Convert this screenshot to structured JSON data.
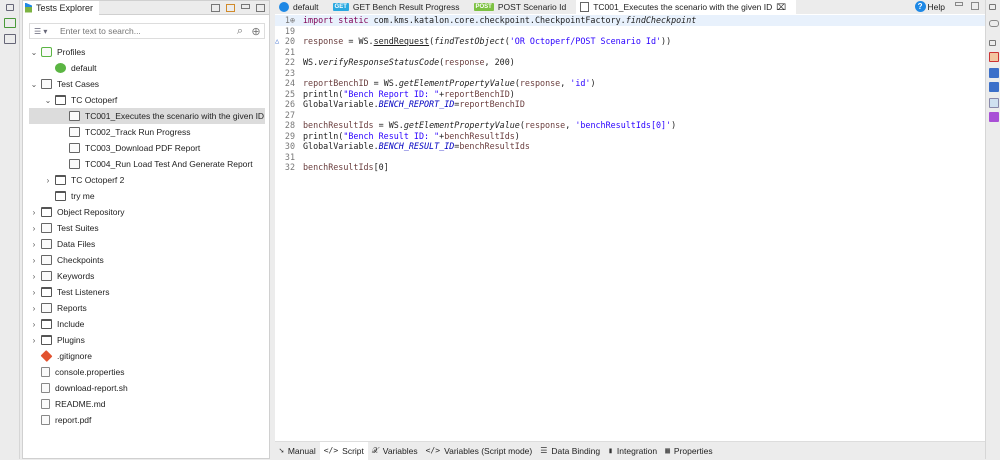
{
  "explorer": {
    "title": "Tests Explorer",
    "search_placeholder": "Enter text to search...",
    "tree": [
      {
        "label": "Profiles",
        "depth": 0,
        "chev": "v",
        "icon": "profile"
      },
      {
        "label": "default",
        "depth": 1,
        "chev": "",
        "icon": "green"
      },
      {
        "label": "Test Cases",
        "depth": 0,
        "chev": "v",
        "icon": "tc"
      },
      {
        "label": "TC Octoperf",
        "depth": 1,
        "chev": "v",
        "icon": "folder"
      },
      {
        "label": "TC001_Executes the scenario with the given ID",
        "depth": 2,
        "chev": "",
        "icon": "tc",
        "selected": true
      },
      {
        "label": "TC002_Track Run Progress",
        "depth": 2,
        "chev": "",
        "icon": "tc"
      },
      {
        "label": "TC003_Download PDF Report",
        "depth": 2,
        "chev": "",
        "icon": "tc"
      },
      {
        "label": "TC004_Run Load Test And Generate Report",
        "depth": 2,
        "chev": "",
        "icon": "tc"
      },
      {
        "label": "TC Octoperf 2",
        "depth": 1,
        "chev": ">",
        "icon": "folder"
      },
      {
        "label": "try me",
        "depth": 1,
        "chev": "",
        "icon": "folder"
      },
      {
        "label": "Object Repository",
        "depth": 0,
        "chev": ">",
        "icon": "folder"
      },
      {
        "label": "Test Suites",
        "depth": 0,
        "chev": ">",
        "icon": "tc"
      },
      {
        "label": "Data Files",
        "depth": 0,
        "chev": ">",
        "icon": "tc"
      },
      {
        "label": "Checkpoints",
        "depth": 0,
        "chev": ">",
        "icon": "tc"
      },
      {
        "label": "Keywords",
        "depth": 0,
        "chev": ">",
        "icon": "tc"
      },
      {
        "label": "Test Listeners",
        "depth": 0,
        "chev": ">",
        "icon": "folder"
      },
      {
        "label": "Reports",
        "depth": 0,
        "chev": ">",
        "icon": "tc"
      },
      {
        "label": "Include",
        "depth": 0,
        "chev": ">",
        "icon": "folder"
      },
      {
        "label": "Plugins",
        "depth": 0,
        "chev": ">",
        "icon": "folder"
      },
      {
        "label": ".gitignore",
        "depth": 0,
        "chev": "",
        "icon": "git"
      },
      {
        "label": "console.properties",
        "depth": 0,
        "chev": "",
        "icon": "file"
      },
      {
        "label": "download-report.sh",
        "depth": 0,
        "chev": "",
        "icon": "file"
      },
      {
        "label": "README.md",
        "depth": 0,
        "chev": "",
        "icon": "file"
      },
      {
        "label": "report.pdf",
        "depth": 0,
        "chev": "",
        "icon": "file"
      }
    ]
  },
  "editor": {
    "tabs": [
      {
        "label": "default",
        "badge": "",
        "icon": "x-profile-icon"
      },
      {
        "label": "GET Bench Result Progress",
        "badge": "GET",
        "badge_color": "#29a8e0"
      },
      {
        "label": "POST Scenario Id",
        "badge": "POST",
        "badge_color": "#7cc142"
      },
      {
        "label": "TC001_Executes the scenario with the given ID",
        "badge": "",
        "icon": "test-case-icon",
        "active": true,
        "close": "⌧"
      }
    ],
    "help": "Help",
    "code": [
      {
        "n": "1⊕",
        "cur": true,
        "t": [
          [
            "kw",
            "import static "
          ],
          [
            "",
            "com.kms.katalon.core.checkpoint.CheckpointFactory."
          ],
          [
            "it",
            "findCheckpoint"
          ]
        ]
      },
      {
        "n": "19",
        "t": []
      },
      {
        "n": "20",
        "t": [
          [
            "var",
            "response"
          ],
          [
            "",
            " = WS."
          ],
          [
            "u",
            "sendRequest"
          ],
          [
            "",
            "("
          ],
          [
            "it",
            "findTestObject"
          ],
          [
            "",
            "("
          ],
          [
            "str",
            "'OR Octoperf/POST Scenario Id'"
          ],
          [
            "",
            "))"
          ]
        ]
      },
      {
        "n": "21",
        "t": []
      },
      {
        "n": "22",
        "t": [
          [
            "",
            "WS."
          ],
          [
            "it",
            "verifyResponseStatusCode"
          ],
          [
            "",
            "("
          ],
          [
            "var",
            "response"
          ],
          [
            "",
            ", 200)"
          ]
        ]
      },
      {
        "n": "23",
        "t": []
      },
      {
        "n": "24",
        "t": [
          [
            "var",
            "reportBenchID"
          ],
          [
            "",
            " = WS."
          ],
          [
            "it",
            "getElementPropertyValue"
          ],
          [
            "",
            "("
          ],
          [
            "var",
            "response"
          ],
          [
            "",
            ", "
          ],
          [
            "str",
            "'id'"
          ],
          [
            "",
            ")"
          ]
        ]
      },
      {
        "n": "25",
        "t": [
          [
            "",
            "println("
          ],
          [
            "str",
            "\"Bench Report ID: \""
          ],
          [
            "",
            "+"
          ],
          [
            "var",
            "reportBenchID"
          ],
          [
            "",
            ")"
          ]
        ]
      },
      {
        "n": "26",
        "t": [
          [
            "",
            "GlobalVariable."
          ],
          [
            "fld",
            "BENCH_REPORT_ID"
          ],
          [
            "",
            "="
          ],
          [
            "var",
            "reportBenchID"
          ]
        ]
      },
      {
        "n": "27",
        "t": []
      },
      {
        "n": "28",
        "t": [
          [
            "var",
            "benchResultIds"
          ],
          [
            "",
            " = WS."
          ],
          [
            "it",
            "getElementPropertyValue"
          ],
          [
            "",
            "("
          ],
          [
            "var",
            "response"
          ],
          [
            "",
            ", "
          ],
          [
            "str",
            "'benchResultIds[0]'"
          ],
          [
            "",
            ")"
          ]
        ]
      },
      {
        "n": "29",
        "t": [
          [
            "",
            "println("
          ],
          [
            "str",
            "\"Bench Result ID: \""
          ],
          [
            "",
            "+"
          ],
          [
            "var",
            "benchResultIds"
          ],
          [
            "",
            ")"
          ]
        ]
      },
      {
        "n": "30",
        "t": [
          [
            "",
            "GlobalVariable."
          ],
          [
            "fld",
            "BENCH_RESULT_ID"
          ],
          [
            "",
            "="
          ],
          [
            "var",
            "benchResultIds"
          ]
        ]
      },
      {
        "n": "31",
        "t": []
      },
      {
        "n": "32",
        "t": [
          [
            "var",
            "benchResultIds"
          ],
          [
            "",
            "[0]"
          ]
        ]
      }
    ],
    "bottom_tabs": [
      {
        "label": "Manual",
        "icon": "➘"
      },
      {
        "label": "Script",
        "icon": "</>",
        "active": true
      },
      {
        "label": "Variables",
        "icon": "𝒳"
      },
      {
        "label": "Variables (Script mode)",
        "icon": "</>"
      },
      {
        "label": "Data Binding",
        "icon": "☰"
      },
      {
        "label": "Integration",
        "icon": "▮"
      },
      {
        "label": "Properties",
        "icon": "▦"
      }
    ]
  }
}
